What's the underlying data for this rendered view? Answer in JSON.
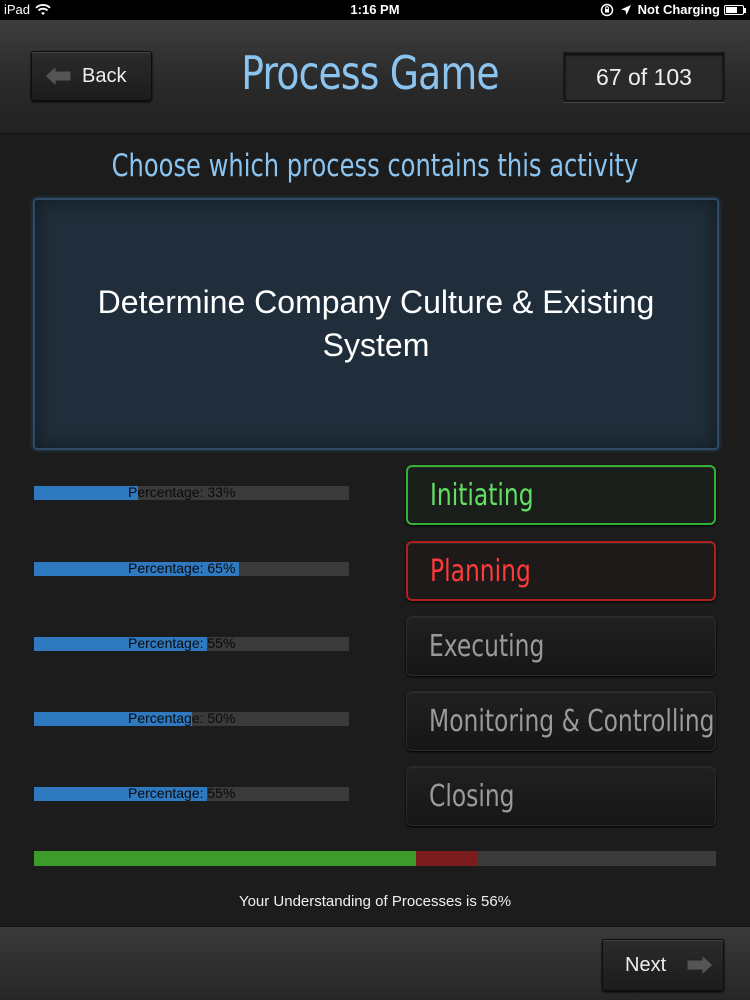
{
  "status_bar": {
    "device": "iPad",
    "time": "1:16 PM",
    "charging": "Not Charging"
  },
  "header": {
    "back_label": "Back",
    "title": "Process Game",
    "counter": "67 of 103"
  },
  "instruction": "Choose which process contains this activity",
  "activity": "Determine Company Culture & Existing System",
  "rows": [
    {
      "process": "Initiating",
      "state": "correct",
      "percent_label": "Percentage: 33%",
      "percent": 33,
      "color": "#63e063"
    },
    {
      "process": "Planning",
      "state": "wrong",
      "percent_label": "Percentage: 65%",
      "percent": 65,
      "color": "#ff3a3a"
    },
    {
      "process": "Executing",
      "state": "neutral",
      "percent_label": "Percentage: 55%",
      "percent": 55
    },
    {
      "process": "Monitoring & Controlling",
      "state": "neutral",
      "percent_label": "Percentage: 50%",
      "percent": 50
    },
    {
      "process": "Closing",
      "state": "neutral",
      "percent_label": "Percentage: 55%",
      "percent": 55
    }
  ],
  "overall": {
    "correct_fraction": 0.56,
    "wrong_fraction": 0.09,
    "correct_color": "#3c9b2a",
    "wrong_color": "#7a1c1c",
    "text": "Your Understanding of Processes is 56%"
  },
  "footer": {
    "next_label": "Next"
  }
}
